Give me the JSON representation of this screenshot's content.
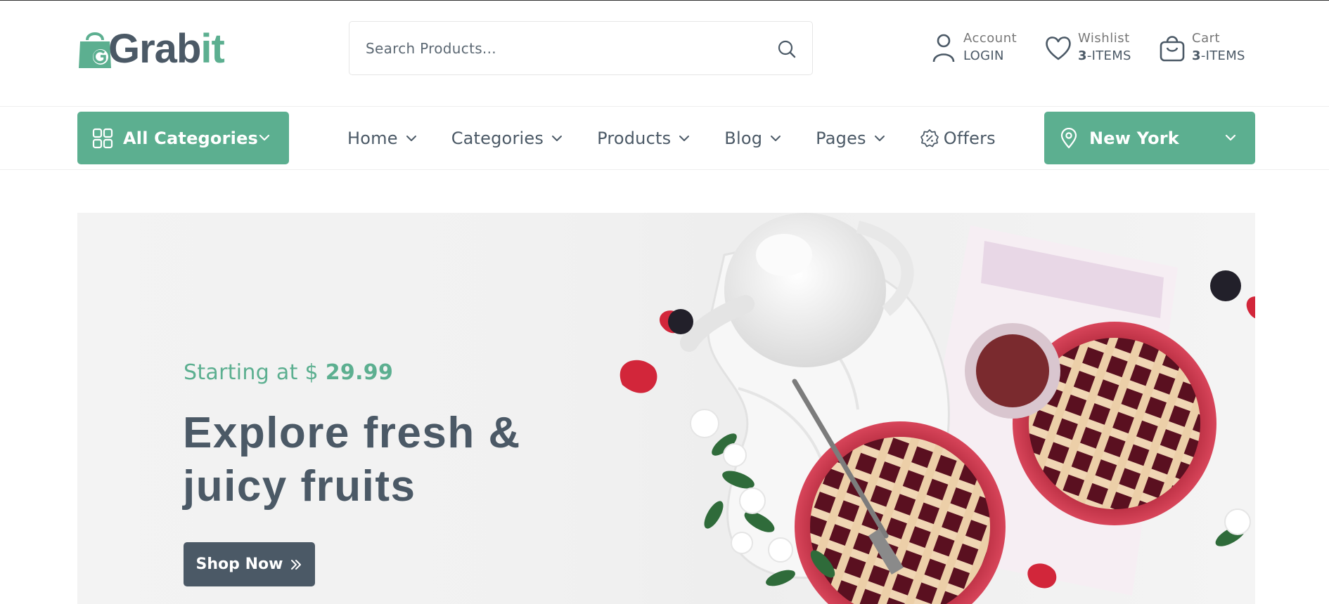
{
  "brand": {
    "name_part1": "Grab",
    "name_part2": "it",
    "bag_letter": "G",
    "colors": {
      "primary": "#5caf90",
      "dark": "#4b5966"
    }
  },
  "search": {
    "placeholder": "Search Products...",
    "icon": "search-icon"
  },
  "header_actions": {
    "account": {
      "label": "Account",
      "value": "LOGIN",
      "icon": "user-icon"
    },
    "wishlist": {
      "label": "Wishlist",
      "count": "3",
      "suffix": "-ITEMS",
      "icon": "heart-icon"
    },
    "cart": {
      "label": "Cart",
      "count": "3",
      "suffix": "-ITEMS",
      "icon": "shopping-bag-icon"
    }
  },
  "nav": {
    "all_categories": {
      "label": "All Categories",
      "icon": "grid-icon"
    },
    "links": [
      {
        "label": "Home",
        "has_dropdown": true
      },
      {
        "label": "Categories",
        "has_dropdown": true
      },
      {
        "label": "Products",
        "has_dropdown": true
      },
      {
        "label": "Blog",
        "has_dropdown": true
      },
      {
        "label": "Pages",
        "has_dropdown": true
      },
      {
        "label": "Offers",
        "has_dropdown": false,
        "icon": "discount-badge-icon"
      }
    ],
    "location": {
      "label": "New York",
      "icon": "map-pin-icon"
    }
  },
  "hero": {
    "subtitle_prefix": "Starting at $ ",
    "subtitle_price": "29.99",
    "title": "Explore fresh & juicy fruits",
    "cta_label": "Shop Now",
    "cta_icon": "double-chevron-right-icon"
  }
}
